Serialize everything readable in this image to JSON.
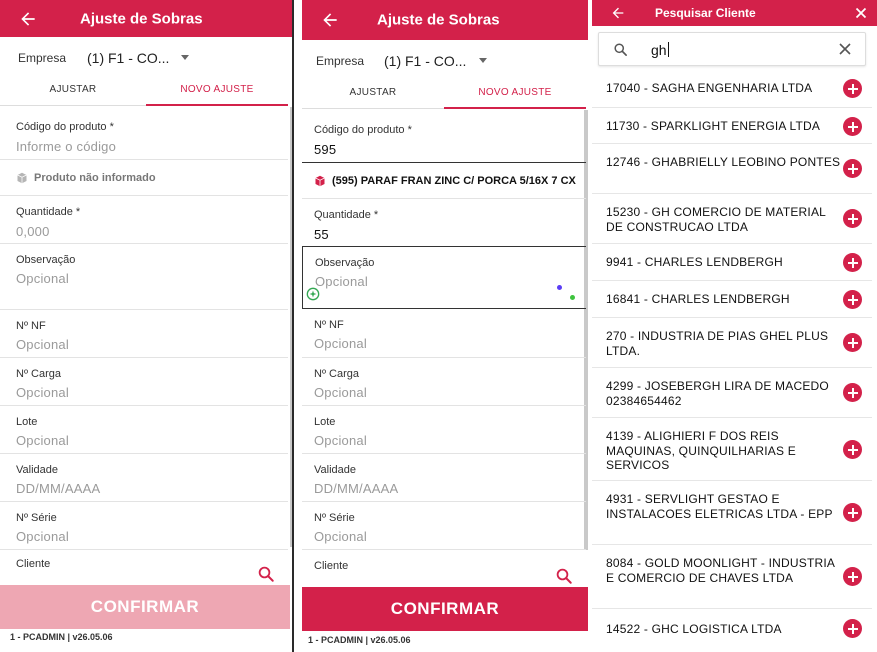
{
  "app": {
    "title": "Ajuste de Sobras",
    "company_label": "Empresa",
    "company_value": "(1) F1 - CO...",
    "tabs": [
      "AJUSTAR",
      "NOVO AJUSTE"
    ],
    "confirm_label": "CONFIRMAR",
    "footer": "1 - PCADMIN  |  v26.05.06"
  },
  "form1": {
    "produto_label": "Código do produto *",
    "produto_placeholder": "Informe o código",
    "produto_info": "Produto não informado",
    "quantidade_label": "Quantidade *",
    "quantidade_value": "0,000",
    "observacao_label": "Observação",
    "observacao_placeholder": "Opcional",
    "nf_label": "Nº NF",
    "nf_placeholder": "Opcional",
    "carga_label": "Nº Carga",
    "carga_placeholder": "Opcional",
    "lote_label": "Lote",
    "lote_placeholder": "Opcional",
    "validade_label": "Validade",
    "validade_placeholder": "DD/MM/AAAA",
    "serie_label": "Nº Série",
    "serie_placeholder": "Opcional",
    "cliente_label": "Cliente"
  },
  "form2": {
    "produto_label": "Código do produto *",
    "produto_value": "595",
    "produto_info": "(595) PARAF FRAN ZINC C/ PORCA 5/16X 7 CX",
    "quantidade_label": "Quantidade *",
    "quantidade_value": "55",
    "observacao_label": "Observação",
    "observacao_placeholder": "Opcional",
    "nf_label": "Nº NF",
    "nf_placeholder": "Opcional",
    "carga_label": "Nº Carga",
    "carga_placeholder": "Opcional",
    "lote_label": "Lote",
    "lote_placeholder": "Opcional",
    "validade_label": "Validade",
    "validade_placeholder": "DD/MM/AAAA",
    "serie_label": "Nº Série",
    "serie_placeholder": "Opcional",
    "cliente_label": "Cliente"
  },
  "search": {
    "title": "Pesquisar Cliente",
    "query": "gh",
    "results": [
      "17040 - SAGHA ENGENHARIA LTDA",
      "11730 - SPARKLIGHT ENERGIA LTDA",
      "12746 - GHABRIELLY LEOBINO PONTES",
      "15230 - GH COMERCIO DE MATERIAL DE CONSTRUCAO LTDA",
      "9941 - CHARLES LENDBERGH",
      "16841 - CHARLES LENDBERGH",
      "270 - INDUSTRIA DE PIAS GHEL PLUS LTDA.",
      "4299 - JOSEBERGH LIRA DE MACEDO 02384654462",
      "4139 - ALIGHIERI F DOS REIS MAQUINAS, QUINQUILHARIAS E SERVICOS",
      "4931 - SERVLIGHT GESTAO E INSTALACOES ELETRICAS LTDA - EPP",
      "8084 - GOLD MOONLIGHT - INDUSTRIA E COMERCIO DE CHAVES LTDA",
      "14522 - GHC LOGISTICA LTDA"
    ]
  },
  "colors": {
    "primary": "#d3214a",
    "primary_disabled": "#eea7b3"
  }
}
